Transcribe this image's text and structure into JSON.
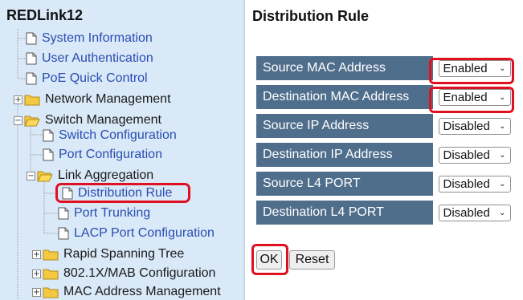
{
  "sidebar": {
    "title": "REDLink12",
    "items": [
      {
        "label": "System Information"
      },
      {
        "label": "User Authentication"
      },
      {
        "label": "PoE Quick Control"
      },
      {
        "label": "Network Management"
      },
      {
        "label": "Switch Management"
      },
      {
        "label": "Switch Configuration"
      },
      {
        "label": "Port Configuration"
      },
      {
        "label": "Link Aggregation"
      },
      {
        "label": "Distribution Rule"
      },
      {
        "label": "Port Trunking"
      },
      {
        "label": "LACP Port Configuration"
      },
      {
        "label": "Rapid Spanning Tree"
      },
      {
        "label": "802.1X/MAB Configuration"
      },
      {
        "label": "MAC Address Management"
      }
    ]
  },
  "main": {
    "title": "Distribution Rule",
    "rules": [
      {
        "label": "Source MAC Address",
        "value": "Enabled"
      },
      {
        "label": "Destination MAC Address",
        "value": "Enabled"
      },
      {
        "label": "Source IP Address",
        "value": "Disabled"
      },
      {
        "label": "Destination IP Address",
        "value": "Disabled"
      },
      {
        "label": "Source L4 PORT",
        "value": "Disabled"
      },
      {
        "label": "Destination L4 PORT",
        "value": "Disabled"
      }
    ],
    "ok_label": "OK",
    "reset_label": "Reset"
  },
  "colors": {
    "sidebar_bg": "#d9e9f8",
    "table_label_bg": "#4f6e8c",
    "highlight": "#e01020",
    "link": "#2a4db0"
  }
}
